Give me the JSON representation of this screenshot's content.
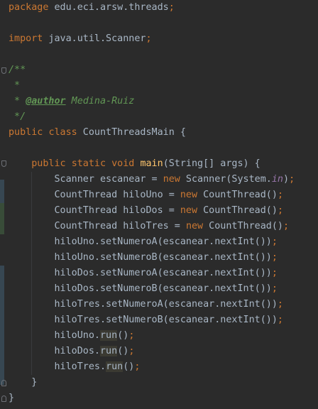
{
  "code": {
    "package_kw": "package",
    "package_name": " edu.eci.arsw.threads",
    "semi": ";",
    "import_kw": "import",
    "import_name": " java.util.Scanner",
    "doc_open": "/**",
    "doc_star": " *",
    "doc_author_prefix": " * ",
    "doc_author_tag": "@author",
    "doc_author_name": " Medina-Ruiz",
    "doc_close": " */",
    "public_kw": "public",
    "class_kw": "class",
    "class_name": " CountThreadsMain {",
    "static_kw": "static",
    "void_kw": "void",
    "main_name": "main",
    "main_params": "(String[] args) {",
    "scanner_decl": "Scanner escanear = ",
    "new_kw": "new",
    "scanner_ctor": " Scanner(System.",
    "in_field": "in",
    "close_paren_semi": ");",
    "t1_decl": "CountThread hiloUno = ",
    "t2_decl": "CountThread hiloDos = ",
    "t3_decl": "CountThread hiloTres = ",
    "ct_ctor": " CountThread()",
    "l1": "hiloUno.setNumeroA(escanear.nextInt())",
    "l2": "hiloUno.setNumeroB(escanear.nextInt())",
    "l3": "hiloDos.setNumeroA(escanear.nextInt())",
    "l4": "hiloDos.setNumeroB(escanear.nextInt())",
    "l5": "hiloTres.setNumeroA(escanear.nextInt())",
    "l6": "hiloTres.setNumeroB(escanear.nextInt())",
    "r1": "hiloUno.",
    "r2": "hiloDos.",
    "r3": "hiloTres.",
    "run": "run",
    "call_end": "()",
    "close_method": "}",
    "close_class": "}"
  },
  "colors": {
    "background": "#2b2b2b",
    "keyword": "#cc7832",
    "text": "#a9b7c6",
    "doc_comment": "#629755",
    "method_declaration": "#ffc66d",
    "static_field": "#9876aa",
    "vcs_changed_marker": "#374752",
    "vcs_added_marker": "#384c38"
  }
}
